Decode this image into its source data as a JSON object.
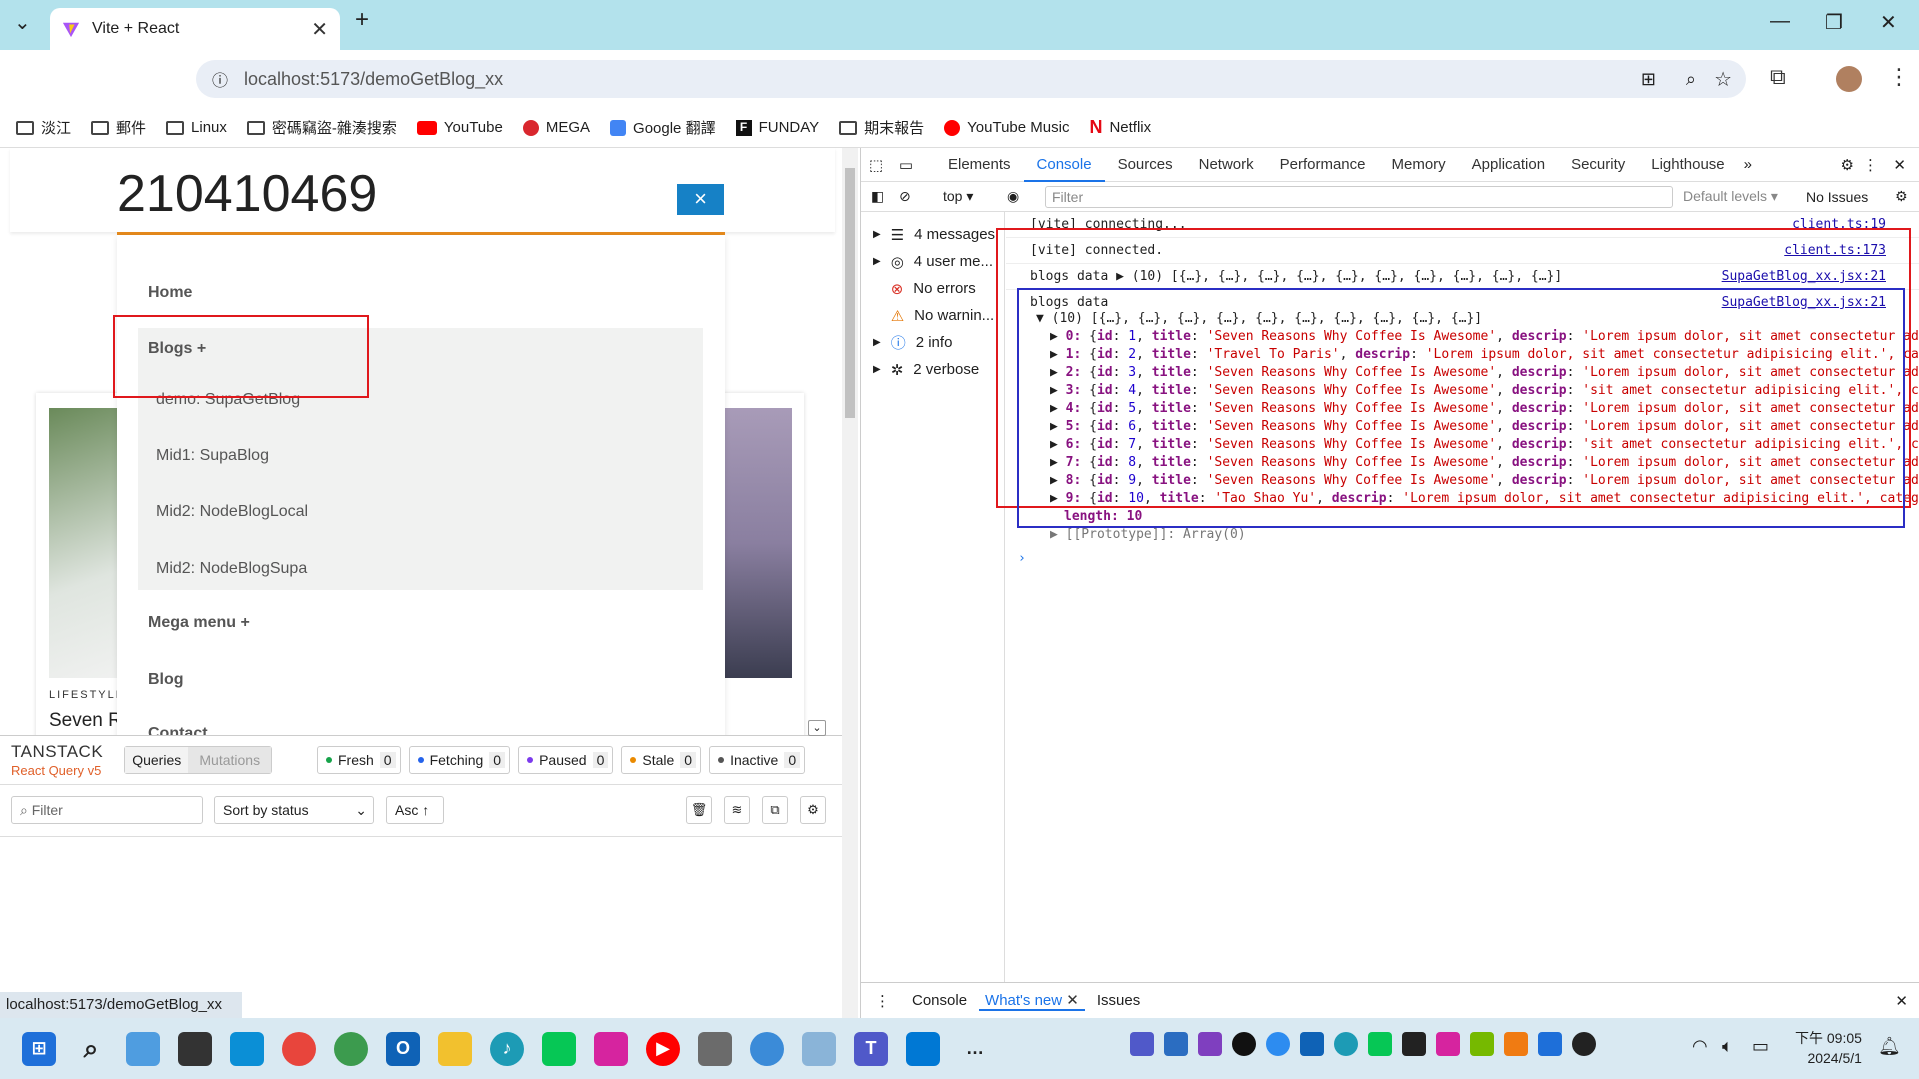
{
  "browser": {
    "tab_title": "Vite + React",
    "url_host": "localhost",
    "url_path": ":5173/demoGetBlog_xx",
    "bookmarks": [
      "淡江",
      "郵件",
      "Linux",
      "密碼竊盜-雜湊搜索",
      "YouTube",
      "MEGA",
      "Google 翻譯",
      "FUNDAY",
      "期末報告",
      "YouTube Music",
      "Netflix"
    ]
  },
  "page": {
    "student_id": "210410469",
    "close_symbol": "×",
    "menu": {
      "home": "Home",
      "blogs": "Blogs +",
      "blogs_items": [
        "demo: SupaGetBlog",
        "Mid1: SupaBlog",
        "Mid2: NodeBlogLocal",
        "Mid2: NodeBlogSupa"
      ],
      "mega": "Mega menu +",
      "blog": "Blog",
      "contact": "Contact"
    },
    "card_category": "LIFESTYLE",
    "card_title_partial": "Seven R"
  },
  "tanstack": {
    "brand": "TANSTACK",
    "sub": "React Query v5",
    "tabs": [
      "Queries",
      "Mutations"
    ],
    "statuses": [
      {
        "label": "Fresh",
        "count": "0",
        "color": "#16a34a"
      },
      {
        "label": "Fetching",
        "count": "0",
        "color": "#2563eb"
      },
      {
        "label": "Paused",
        "count": "0",
        "color": "#7c3aed"
      },
      {
        "label": "Stale",
        "count": "0",
        "color": "#ea8a00"
      },
      {
        "label": "Inactive",
        "count": "0",
        "color": "#555555"
      }
    ],
    "filter_placeholder": "Filter",
    "sort_label": "Sort by status",
    "asc_label": "Asc ↑"
  },
  "status_url": "localhost:5173/demoGetBlog_xx",
  "devtools": {
    "tabs": [
      "Elements",
      "Console",
      "Sources",
      "Network",
      "Performance",
      "Memory",
      "Application",
      "Security",
      "Lighthouse"
    ],
    "active_tab": "Console",
    "context": "top",
    "filter_placeholder": "Filter",
    "levels": "Default levels",
    "issues": "No Issues",
    "sidebar": [
      {
        "label": "4 messages",
        "icon": "list-icon"
      },
      {
        "label": "4 user me...",
        "icon": "user-icon"
      },
      {
        "label": "No errors",
        "icon": "error-icon"
      },
      {
        "label": "No warnin...",
        "icon": "warning-icon"
      },
      {
        "label": "2 info",
        "icon": "info-icon"
      },
      {
        "label": "2 verbose",
        "icon": "bug-icon"
      }
    ],
    "console_lines": [
      {
        "text": "[vite] connecting...",
        "src": "client.ts:19"
      },
      {
        "text": "[vite] connected.",
        "src": "client.ts:173"
      },
      {
        "text": "blogs data ▶ (10) [{…}, {…}, {…}, {…}, {…}, {…}, {…}, {…}, {…}, {…}]",
        "src": "SupaGetBlog_xx.jsx:21"
      },
      {
        "text": "blogs data",
        "src": "SupaGetBlog_xx.jsx:21"
      }
    ],
    "array_header": "▼ (10) [{…}, {…}, {…}, {…}, {…}, {…}, {…}, {…}, {…}, {…}]",
    "items": [
      {
        "i": "0",
        "id": "1",
        "title": "'Seven Reasons Why Coffee Is Awesome'",
        "descrip": "'Lorem ipsum dolor, sit amet consectetur adip"
      },
      {
        "i": "1",
        "id": "2",
        "title": "'Travel To Paris'",
        "descrip": "'Lorem ipsum dolor, sit amet consectetur adipisicing elit.', cate"
      },
      {
        "i": "2",
        "id": "3",
        "title": "'Seven Reasons Why Coffee Is Awesome'",
        "descrip": "'Lorem ipsum dolor, sit amet consectetur adip"
      },
      {
        "i": "3",
        "id": "4",
        "title": "'Seven Reasons Why Coffee Is Awesome'",
        "descrip": "'sit amet consectetur adipisicing elit.', cat"
      },
      {
        "i": "4",
        "id": "5",
        "title": "'Seven Reasons Why Coffee Is Awesome'",
        "descrip": "'Lorem ipsum dolor, sit amet consectetur adip"
      },
      {
        "i": "5",
        "id": "6",
        "title": "'Seven Reasons Why Coffee Is Awesome'",
        "descrip": "'Lorem ipsum dolor, sit amet consectetur adip"
      },
      {
        "i": "6",
        "id": "7",
        "title": "'Seven Reasons Why Coffee Is Awesome'",
        "descrip": "'sit amet consectetur adipisicing elit.', cat"
      },
      {
        "i": "7",
        "id": "8",
        "title": "'Seven Reasons Why Coffee Is Awesome'",
        "descrip": "'Lorem ipsum dolor, sit amet consectetur adip"
      },
      {
        "i": "8",
        "id": "9",
        "title": "'Seven Reasons Why Coffee Is Awesome'",
        "descrip": "'Lorem ipsum dolor, sit amet consectetur adip"
      },
      {
        "i": "9",
        "id": "10",
        "title": "'Tao Shao Yu'",
        "descrip": "'Lorem ipsum dolor, sit amet consectetur adipisicing elit.', categor"
      }
    ],
    "length_line": "length: 10",
    "prototype_line": "▶ [[Prototype]]: Array(0)",
    "drawer_tabs": [
      "Console",
      "What's new",
      "Issues"
    ]
  },
  "taskbar": {
    "time": "下午 09:05",
    "date": "2024/5/1"
  }
}
